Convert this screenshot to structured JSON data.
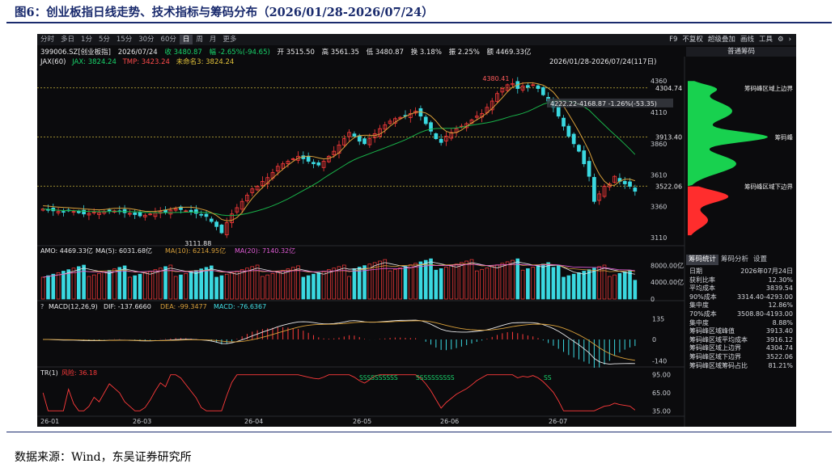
{
  "figure_title": "图6：创业板指日线走势、技术指标与筹码分布（2026/01/28-2026/07/24）",
  "source": "数据来源：Wind，东吴证券研究所",
  "toolbar": {
    "tabs": [
      "分时",
      "多日",
      "1分",
      "5分",
      "15分",
      "30分",
      "60分",
      "日",
      "周",
      "月",
      "更多"
    ],
    "active_tab": "日",
    "right": [
      "F9",
      "不复权",
      "超级叠加",
      "画线",
      "工具",
      "⚙",
      "›"
    ]
  },
  "info": {
    "code": "399006.SZ[创业板指]",
    "date": "2026/07/24",
    "close": "收 3480.87",
    "change": "幅 -2.65%(-94.65)",
    "open": "开 3515.50",
    "high": "高 3561.35",
    "low": "低 3480.87",
    "turnover": "换 3.18%",
    "amplitude": "振 2.25%",
    "amount": "额 4469.33亿"
  },
  "ma_legend": {
    "jax": "JAX(60)",
    "jax_val": "JAX: 3824.24",
    "tmp": "TMP: 3423.24",
    "unnamed": "未命名3: 3824.24"
  },
  "range_label": "2026/01/28-2026/07/24(117日)",
  "right_panel": {
    "header": "普通筹码"
  },
  "chart_data": [
    {
      "type": "candlestick",
      "name": "K线",
      "x_labels": [
        "26-01",
        "26-03",
        "26-04",
        "26-05",
        "26-06",
        "26-07"
      ],
      "ylim": [
        3060,
        4400
      ],
      "y_ticks": [
        4360,
        4110,
        3860,
        3610,
        3360,
        3110
      ],
      "price_labels": [
        "4304.74",
        "3913.40",
        "3522.06"
      ],
      "annotations": {
        "high": "4380.41",
        "low": "3111.88",
        "measure": "4222.22-4168.87  -1.26%(-53.35)"
      },
      "reference_lines": [
        4304.74,
        3913.4,
        3522.06
      ],
      "closes": [
        3340,
        3335,
        3325,
        3320,
        3315,
        3330,
        3320,
        3310,
        3300,
        3305,
        3315,
        3310,
        3320,
        3330,
        3325,
        3320,
        3310,
        3305,
        3295,
        3285,
        3290,
        3300,
        3310,
        3320,
        3315,
        3330,
        3340,
        3335,
        3325,
        3315,
        3305,
        3290,
        3280,
        3240,
        3200,
        3150,
        3230,
        3300,
        3350,
        3400,
        3450,
        3500,
        3520,
        3560,
        3590,
        3630,
        3680,
        3700,
        3720,
        3740,
        3760,
        3740,
        3720,
        3700,
        3690,
        3720,
        3760,
        3800,
        3850,
        3900,
        3950,
        3920,
        3880,
        3860,
        3900,
        3940,
        3980,
        4010,
        4040,
        4060,
        4070,
        4080,
        4100,
        4120,
        4080,
        4020,
        3960,
        3900,
        3870,
        3920,
        3950,
        3980,
        4000,
        4020,
        4050,
        4080,
        4100,
        4150,
        4200,
        4260,
        4300,
        4330,
        4340,
        4300,
        4320,
        4310,
        4330,
        4300,
        4250,
        4200,
        4150,
        4080,
        4000,
        3920,
        3860,
        3800,
        3700,
        3600,
        3400,
        3460,
        3520,
        3540,
        3600,
        3560,
        3540,
        3520,
        3480.87
      ]
    },
    {
      "type": "bar",
      "name": "AMO",
      "legend": [
        "AMO: 4469.33亿",
        "MA(5): 6031.68亿",
        "MA(10): 6214.95亿",
        "MA(20): 7140.32亿"
      ],
      "y_ticks": [
        "8000.00亿",
        "4000.00亿",
        "0"
      ],
      "ylim": [
        0,
        10000
      ]
    },
    {
      "type": "line",
      "name": "MACD",
      "legend": [
        "MACD(12,26,9)",
        "DIF: -137.6660",
        "DEA: -99.3477",
        "MACD: -76.6367"
      ],
      "y_ticks": [
        "135",
        "0",
        "-140"
      ],
      "ylim": [
        -180,
        180
      ]
    },
    {
      "type": "line",
      "name": "TR",
      "legend": [
        "TR(1)",
        "风险: 36.18"
      ],
      "y_ticks": [
        "95.00",
        "65.00",
        "35.00"
      ],
      "signals": [
        "SSSSSSSSSS",
        "SSSSSSSSSS",
        "SS"
      ],
      "ylim": [
        30,
        100
      ]
    }
  ],
  "chip_stats": {
    "tabs": [
      "筹码统计",
      "筹码分析",
      "设置"
    ],
    "rows": [
      [
        "日期",
        "2026年07月24日"
      ],
      [
        "获利比率",
        "12.30%"
      ],
      [
        "平均成本",
        "3839.54"
      ],
      [
        "90%成本",
        "3314.40-4293.00"
      ],
      [
        "集中度",
        "12.86%"
      ],
      [
        "70%成本",
        "3508.80-4193.00"
      ],
      [
        "集中度",
        "8.88%"
      ],
      [
        "筹码峰区域峰值",
        "3913.40"
      ],
      [
        "筹码峰区域平均成本",
        "3916.12"
      ],
      [
        "筹码峰区域上边界",
        "4304.74"
      ],
      [
        "筹码峰区域下边界",
        "3522.06"
      ],
      [
        "筹码峰区域筹码占比",
        "81.21%"
      ]
    ],
    "chip_labels": [
      "筹码峰区域上边界",
      "筹码峰",
      "筹码峰区域下边界"
    ]
  },
  "colors": {
    "up": "#ff3b3b",
    "down": "#3ad8e0",
    "bg": "#0b0b0d",
    "ma_green": "#19b34a",
    "ma_orange": "#d9a03a",
    "title": "#1a2b6d"
  }
}
